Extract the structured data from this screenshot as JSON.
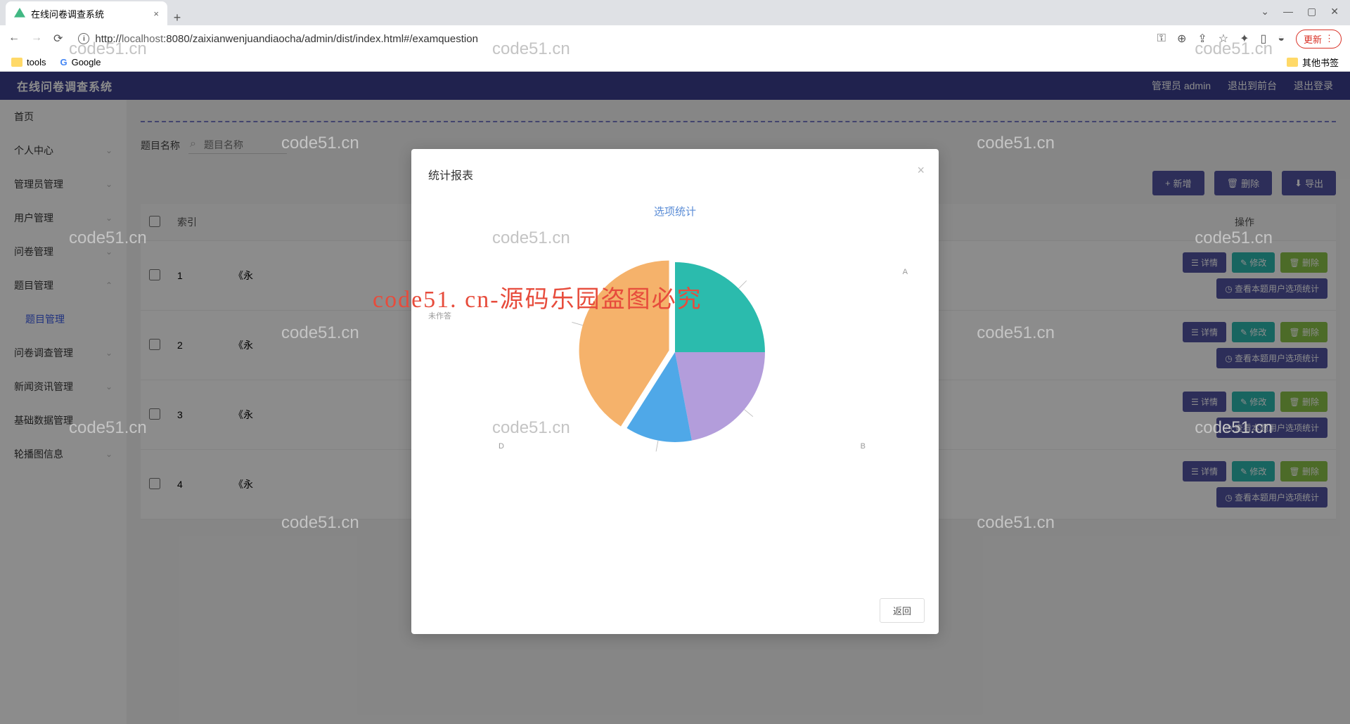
{
  "browser": {
    "tab_title": "在线问卷调查系统",
    "url_host": "localhost",
    "url_path": ":8080/zaixianwenjuandiaocha/admin/dist/index.html#/examquestion",
    "update_btn": "更新",
    "bookmarks": {
      "tools": "tools",
      "google": "Google",
      "other": "其他书签"
    }
  },
  "header": {
    "title": "在线问卷调查系统",
    "user": "管理员 admin",
    "logout_front": "退出到前台",
    "logout": "退出登录"
  },
  "sidebar": {
    "items": [
      "首页",
      "个人中心",
      "管理员管理",
      "用户管理",
      "问卷管理",
      "题目管理",
      "问卷调查管理",
      "新闻资讯管理",
      "基础数据管理",
      "轮播图信息"
    ],
    "sub_item": "题目管理"
  },
  "page": {
    "search_label": "题目名称",
    "search_placeholder": "题目名称",
    "add_btn": "新增",
    "delete_btn": "删除",
    "export_btn": "导出",
    "col_index": "索引",
    "col_ops": "操作",
    "row_btn_detail": "详情",
    "row_btn_edit": "修改",
    "row_btn_delete": "删除",
    "row_btn_stat": "查看本题用户选项统计",
    "rows": [
      {
        "index": "1",
        "name": "《永"
      },
      {
        "index": "2",
        "name": "《永"
      },
      {
        "index": "3",
        "name": "《永"
      },
      {
        "index": "4",
        "name": "《永"
      }
    ]
  },
  "modal": {
    "title": "统计报表",
    "chart_title": "选项统计",
    "return_btn": "返回",
    "label_a": "A",
    "label_b": "B",
    "label_d": "D",
    "label_unanswered": "未作答"
  },
  "watermark": {
    "text": "code51.cn",
    "red": "code51. cn-源码乐园盗图必究"
  },
  "chart_data": {
    "type": "pie",
    "title": "选项统计",
    "series": [
      {
        "name": "A",
        "value": 25,
        "color": "#2bbbad"
      },
      {
        "name": "B",
        "value": 22,
        "color": "#b39ddb"
      },
      {
        "name": "D",
        "value": 12,
        "color": "#4fa8e8"
      },
      {
        "name": "未作答",
        "value": 41,
        "color": "#f5b26b"
      }
    ]
  }
}
